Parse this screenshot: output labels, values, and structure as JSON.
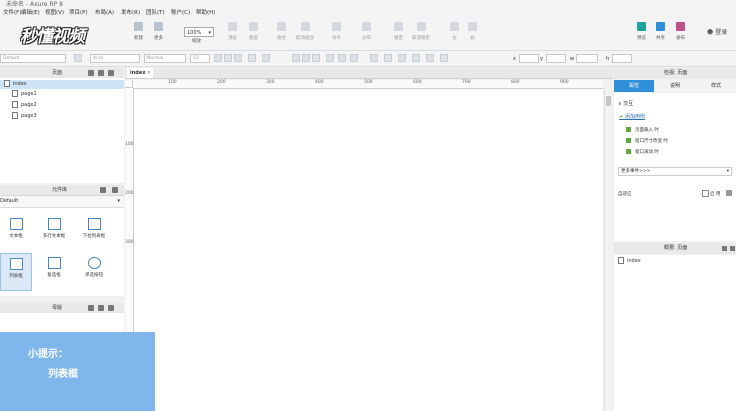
{
  "window": {
    "title": "未命名 - Axure RP 8"
  },
  "menu": [
    "文件(F)",
    "编辑(E)",
    "视图(V)",
    "项目(P)",
    "布局(A)",
    "发布(R)",
    "团队(T)",
    "账户(C)",
    "帮助(H)"
  ],
  "logo_text": "秒懂视频",
  "toolbar": {
    "items": [
      {
        "label": "新建"
      },
      {
        "label": "更多"
      },
      {
        "label": "缩放"
      },
      {
        "label": "顶层"
      },
      {
        "label": "底层"
      },
      {
        "label": "组合"
      },
      {
        "label": "取消组合"
      },
      {
        "label": "对齐"
      },
      {
        "label": "分布"
      },
      {
        "label": "锁定"
      },
      {
        "label": "取消锁定"
      },
      {
        "label": "左"
      },
      {
        "label": "右"
      },
      {
        "label": "预览"
      },
      {
        "label": "共享"
      },
      {
        "label": "发布"
      },
      {
        "label": "登录"
      }
    ],
    "zoom_value": "100%"
  },
  "stylebar": {
    "style": "Default",
    "font": "Arial",
    "weight": "Normal",
    "size": "13",
    "x_label": "x",
    "y_label": "y",
    "w_label": "w",
    "h_label": "h"
  },
  "pages_panel": {
    "title": "页面",
    "items": [
      "index",
      "page1",
      "page2",
      "page3"
    ]
  },
  "widgets_panel": {
    "title": "元件库",
    "library": "Default",
    "items": [
      "文本框",
      "多行文本框",
      "下拉列表框",
      "列表框",
      "复选框",
      "单选按钮"
    ]
  },
  "masters_panel": {
    "title": "母版"
  },
  "canvas": {
    "tab": "index",
    "ruler_top": [
      "100",
      "200",
      "300",
      "400",
      "500",
      "600",
      "700",
      "800",
      "900"
    ],
    "ruler_left": [
      "100",
      "200",
      "300"
    ]
  },
  "inspector": {
    "title": "检视: 页面",
    "tabs": [
      "属性",
      "说明",
      "样式"
    ],
    "section": "交互",
    "add_case": "添加用例",
    "events": [
      "页面载入 时",
      "窗口尺寸改变 时",
      "窗口滚动 时"
    ],
    "more_events": "更多事件>>>",
    "adaptive_label": "自适应",
    "enable_label": "启 用"
  },
  "outline": {
    "title": "概要: 页面",
    "item": "index"
  },
  "tip": {
    "title": "小提示：",
    "text": "列表框"
  },
  "colors": {
    "accent": "#4a86c5",
    "tip_bg": "#7fb6ec",
    "selected_row": "#cfe3f7",
    "event_green": "#5fa83a"
  }
}
